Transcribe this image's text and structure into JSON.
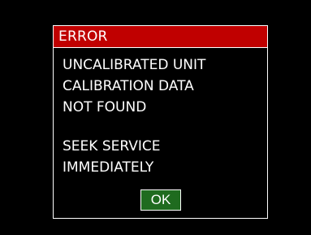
{
  "dialog": {
    "title": "ERROR",
    "message_lines": [
      "UNCALIBRATED UNIT",
      "CALIBRATION DATA",
      "NOT FOUND",
      "SEEK SERVICE",
      "IMMEDIATELY"
    ],
    "ok_label": "OK"
  },
  "colors": {
    "background": "#000000",
    "title_bar": "#c00000",
    "ok_button": "#1f6b1f",
    "text": "#ffffff"
  }
}
